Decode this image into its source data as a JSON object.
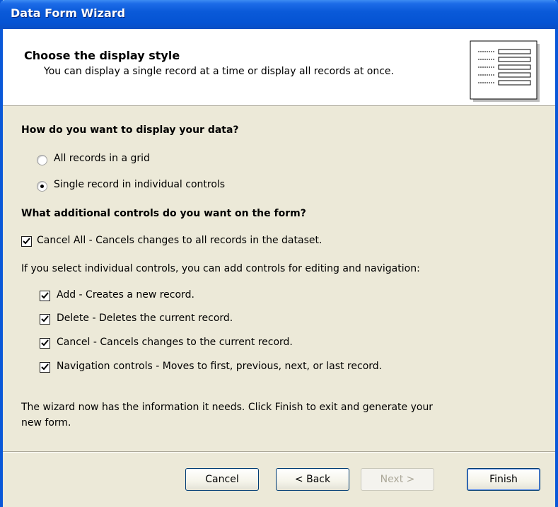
{
  "window": {
    "title": "Data Form Wizard"
  },
  "header": {
    "title": "Choose the display style",
    "subtitle": "You can display a single record at a time or display all records at once.",
    "icon": "form-preview-icon"
  },
  "display": {
    "question": "How do you want to display your data?",
    "options": [
      {
        "label": "All records in a grid",
        "selected": false
      },
      {
        "label": "Single record in individual controls",
        "selected": true
      }
    ]
  },
  "controls": {
    "question": "What additional controls do you want on the form?",
    "cancel_all": {
      "label": "Cancel All - Cancels changes to all records in the dataset.",
      "checked": true
    },
    "individual_note": "If you select individual controls, you can add controls for editing and navigation:",
    "items": [
      {
        "label": "Add - Creates a new record.",
        "checked": true
      },
      {
        "label": "Delete - Deletes the current record.",
        "checked": true
      },
      {
        "label": "Cancel - Cancels changes to the current record.",
        "checked": true
      },
      {
        "label": "Navigation controls - Moves to first, previous, next, or last record.",
        "checked": true
      }
    ]
  },
  "footer_note": {
    "line1": "The wizard now has the information it needs. Click Finish to exit and generate your",
    "line2": "new form."
  },
  "buttons": {
    "cancel": "Cancel",
    "back": "< Back",
    "next": "Next >",
    "finish": "Finish"
  },
  "colors": {
    "titlebar": "#0553d3",
    "dialog_bg": "#ece9d8",
    "header_bg": "#ffffff"
  }
}
